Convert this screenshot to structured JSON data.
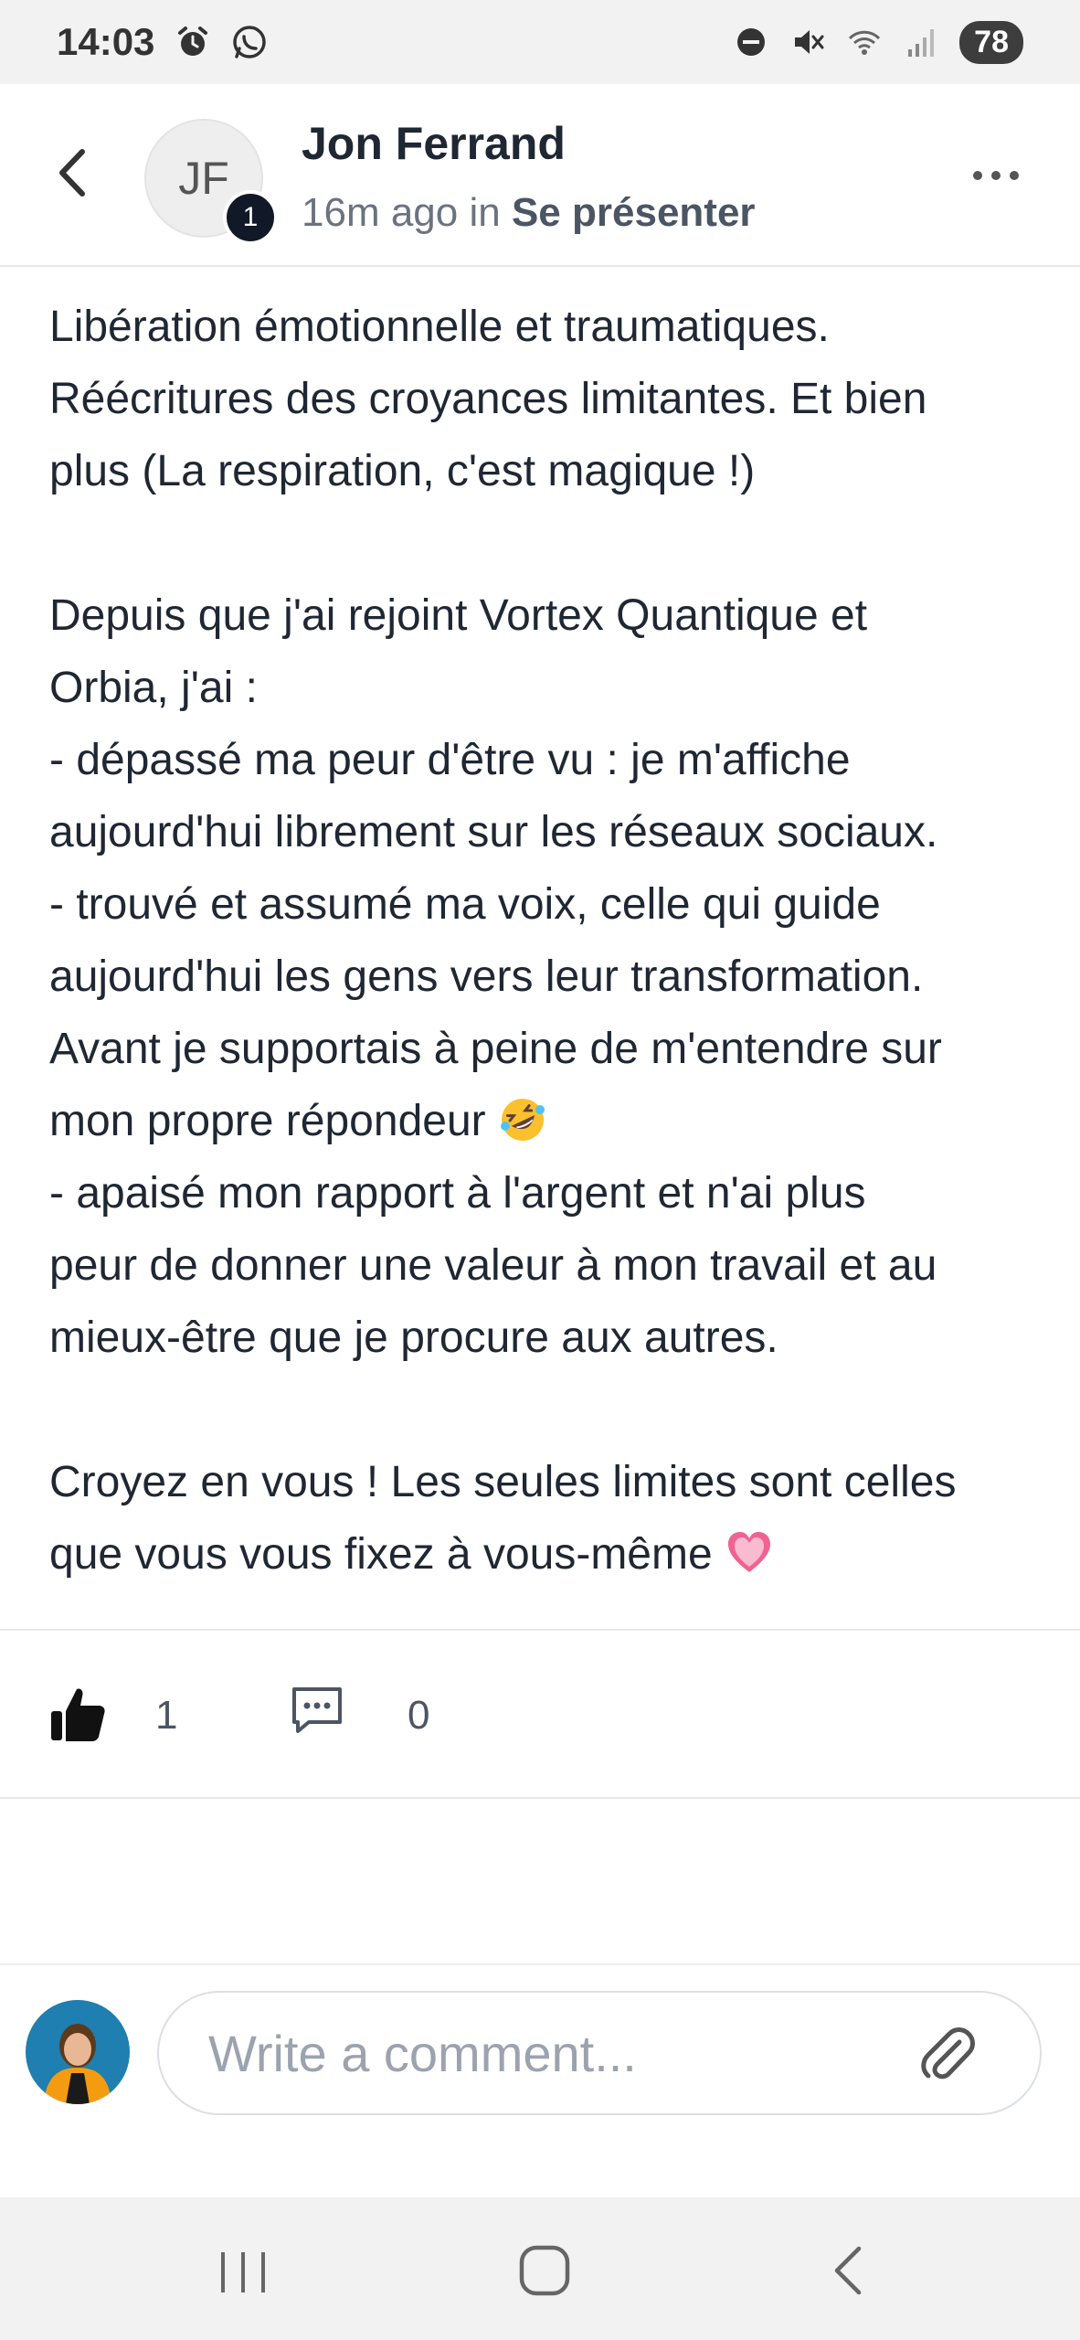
{
  "status_bar": {
    "time": "14:03",
    "battery": "78",
    "icons": [
      "alarm-icon",
      "whatsapp-icon",
      "dnd-icon",
      "mute-icon",
      "wifi-icon",
      "signal-icon"
    ]
  },
  "header": {
    "author_initials": "JF",
    "badge_count": "1",
    "author_name": "Jon Ferrand",
    "time_ago": "16m ago",
    "in_word": "in",
    "space_name": "Se présenter"
  },
  "post": {
    "paragraphs": [
      "Libération émotionnelle et traumatiques.\nRéécritures des croyances limitantes. Et bien\nplus (La respiration, c'est magique !)",
      "Depuis que j'ai rejoint Vortex Quantique et\nOrbia, j'ai :\n- dépassé ma peur d'être vu : je m'affiche\naujourd'hui librement sur les réseaux sociaux.\n- trouvé et assumé ma voix, celle qui guide\naujourd'hui les gens vers leur transformation.\nAvant je supportais à peine de m'entendre sur\nmon propre répondeur",
      "- apaisé mon rapport à l'argent et n'ai plus\npeur de donner une valeur à mon travail et au\nmieux-être que je procure aux autres.",
      "Croyez en vous ! Les seules limites sont celles\nque vous vous fixez à vous-même"
    ],
    "emojis": [
      "rofl-emoji",
      "pink-heart-emoji"
    ]
  },
  "reactions": {
    "like_count": "1",
    "comment_count": "0"
  },
  "composer": {
    "placeholder": "Write a comment..."
  },
  "colors": {
    "text": "#1f2733",
    "muted": "#6b7280",
    "border": "#e6e8ec",
    "badge": "#111827",
    "system_bar": "#f2f2f2"
  }
}
